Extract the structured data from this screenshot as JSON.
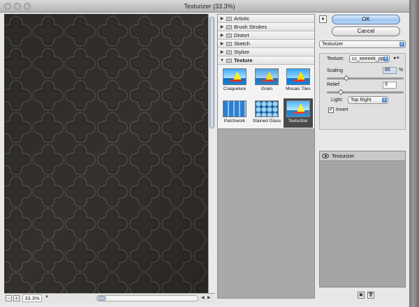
{
  "window": {
    "title": "Texturizer (33.3%)"
  },
  "preview": {
    "zoom": "33.3%",
    "zoom_out": "−",
    "zoom_in": "+"
  },
  "categories": [
    {
      "label": "Artistic",
      "open": false
    },
    {
      "label": "Brush Strokes",
      "open": false
    },
    {
      "label": "Distort",
      "open": false
    },
    {
      "label": "Sketch",
      "open": false
    },
    {
      "label": "Stylize",
      "open": false
    },
    {
      "label": "Texture",
      "open": true
    }
  ],
  "texture_filters": [
    {
      "label": "Craquelure",
      "selected": false
    },
    {
      "label": "Grain",
      "selected": false
    },
    {
      "label": "Mosaic Tiles",
      "selected": false
    },
    {
      "label": "Patchwork",
      "selected": false
    },
    {
      "label": "Stained Glass",
      "selected": false
    },
    {
      "label": "Texturizer",
      "selected": true
    }
  ],
  "buttons": {
    "ok": "OK",
    "cancel": "Cancel"
  },
  "filter_select": {
    "value": "Texturizer"
  },
  "settings": {
    "texture_label": "Texture:",
    "texture_value": "cc_eeeeek_pp...",
    "scaling_label": "Scaling",
    "scaling_value": "85",
    "scaling_unit": "%",
    "scaling_fraction": 0.25,
    "relief_label": "Relief",
    "relief_value": "9",
    "relief_fraction": 0.18,
    "light_label": "Light:",
    "light_value": "Top Right",
    "invert_label": "Invert",
    "invert_checked": true
  },
  "layers": [
    {
      "name": "Texturizer"
    }
  ],
  "icons": {
    "collapse": "collapse-arrow-icon",
    "menu": "panel-menu-icon",
    "eye": "eye-icon",
    "new_layer": "new-effect-layer-icon",
    "delete_layer": "delete-effect-layer-icon"
  },
  "colors": {
    "default_button": "#9fc6f0",
    "preview_bg": "#2e2c29",
    "selected_thumb": "#4a4a4a"
  }
}
